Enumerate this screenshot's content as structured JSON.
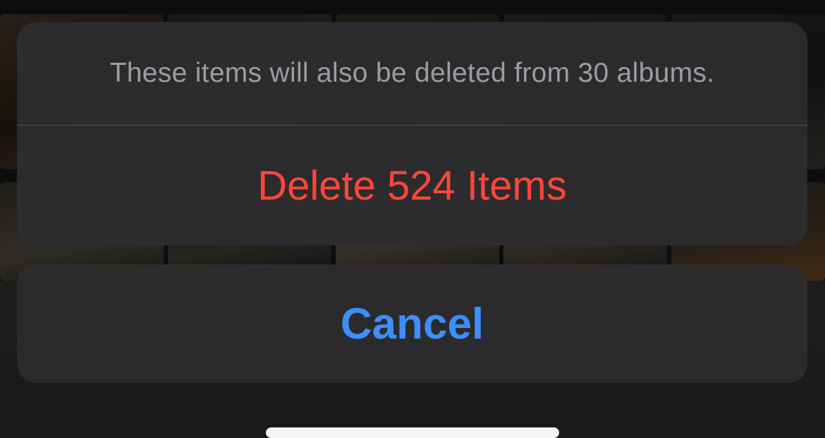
{
  "action_sheet": {
    "message": "These items will also be deleted from 30 albums.",
    "delete_label": "Delete 524 Items",
    "cancel_label": "Cancel"
  },
  "colors": {
    "destructive": "#ff453a",
    "accent": "#3e8ef7",
    "sheet_background": "#2c2c2e",
    "message_text": "#9c9ca1"
  }
}
